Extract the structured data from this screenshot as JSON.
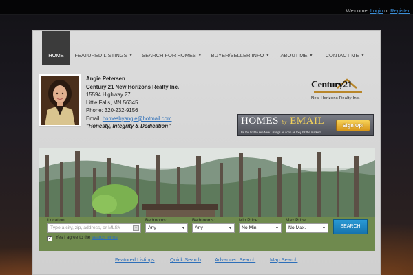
{
  "topbar": {
    "welcome_text": "Welcome,",
    "login_label": "Login",
    "or_text": "or",
    "register_label": "Register"
  },
  "nav": {
    "items": [
      {
        "label": "HOME",
        "has_dropdown": false
      },
      {
        "label": "FEATURED LISTINGS",
        "has_dropdown": true
      },
      {
        "label": "SEARCH FOR HOMES",
        "has_dropdown": true
      },
      {
        "label": "BUYER/SELLER INFO",
        "has_dropdown": true
      },
      {
        "label": "ABOUT ME",
        "has_dropdown": true
      },
      {
        "label": "CONTACT ME",
        "has_dropdown": true
      }
    ],
    "caret": "▼"
  },
  "agent": {
    "name": "Angie Petersen",
    "company": "Century 21 New Horizons Realty Inc.",
    "address1": "15594 Highway 27",
    "address2": "Little Falls, MN 56345",
    "phone_label": "Phone:",
    "phone": "320-232-9156",
    "email_label": "Email:",
    "email": "homesbyangie@hotmail.com",
    "motto": "\"Honesty, Integrity & Dedication\""
  },
  "logo": {
    "name": "Century21",
    "subtitle": "New Horizons Realty Inc."
  },
  "homes_by_email": {
    "title_homes": "HOMES",
    "title_by": "by",
    "title_email": "EMAIL",
    "tagline": "Be the first to see New Listings as soon as they hit the market!",
    "signup_label": "Sign Up!"
  },
  "search": {
    "location_label": "Location:",
    "location_placeholder": "Type a city, zip, address, or MLS#",
    "bedrooms_label": "Bedrooms:",
    "bedrooms_value": "Any",
    "bathrooms_label": "Bathrooms:",
    "bathrooms_value": "Any",
    "min_price_label": "Min Price:",
    "min_price_value": "No Min.",
    "max_price_label": "Max Price:",
    "max_price_value": "No Max.",
    "search_button": "SEARCH",
    "agree_text": "Yes I agree to the",
    "terms_link": "search terms",
    "agree_checked": true
  },
  "bottom_links": {
    "featured": "Featured Listings",
    "quick": "Quick Search",
    "advanced": "Advanced Search",
    "map": "Map Search"
  },
  "colors": {
    "accent_link": "#2d6fb9",
    "nav_active_bg": "#3b3b3b",
    "search_button": "#1f86c4",
    "signup_button": "#e8b23a"
  }
}
